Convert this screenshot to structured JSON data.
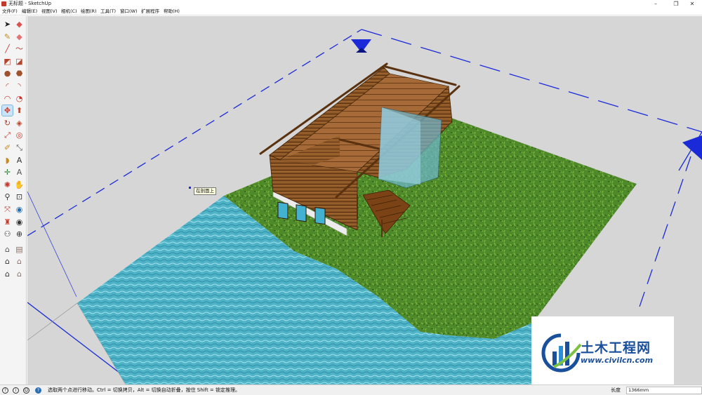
{
  "window": {
    "title": "无标题 - SketchUp",
    "min_glyph": "–",
    "max_glyph": "❐",
    "close_glyph": "✕"
  },
  "menu": [
    "文件(F)",
    "编辑(E)",
    "视图(V)",
    "相机(C)",
    "绘图(R)",
    "工具(T)",
    "窗口(W)",
    "扩展程序",
    "帮助(H)"
  ],
  "toolbar": {
    "tools": [
      {
        "name": "select-tool-icon",
        "glyph": "➤",
        "color": "#222222"
      },
      {
        "name": "eraser-tool-icon",
        "glyph": "◆",
        "color": "#d9534f"
      },
      {
        "name": "paint-bucket-icon",
        "glyph": "✎",
        "color": "#c98a1b"
      },
      {
        "name": "eraser-pink-icon",
        "glyph": "◆",
        "color": "#e57373"
      },
      {
        "name": "line-tool-icon",
        "glyph": "╱",
        "color": "#c0392b"
      },
      {
        "name": "freehand-tool-icon",
        "glyph": "〜",
        "color": "#c0392b"
      },
      {
        "name": "rectangle-tool-icon",
        "glyph": "◩",
        "color": "#b5442e"
      },
      {
        "name": "rotated-rectangle-icon",
        "glyph": "◪",
        "color": "#b5442e"
      },
      {
        "name": "circle-tool-icon",
        "glyph": "●",
        "color": "#a0522d"
      },
      {
        "name": "polygon-tool-icon",
        "glyph": "⬣",
        "color": "#a0522d"
      },
      {
        "name": "arc-tool-icon",
        "glyph": "◜",
        "color": "#c0392b"
      },
      {
        "name": "two-point-arc-icon",
        "glyph": "◝",
        "color": "#c0392b"
      },
      {
        "name": "three-point-arc-icon",
        "glyph": "◠",
        "color": "#c0392b"
      },
      {
        "name": "pie-tool-icon",
        "glyph": "◔",
        "color": "#c0392b"
      },
      {
        "name": "move-tool-icon",
        "glyph": "✥",
        "color": "#c0392b"
      },
      {
        "name": "push-pull-icon",
        "glyph": "⬆",
        "color": "#b5442e"
      },
      {
        "name": "rotate-tool-icon",
        "glyph": "↻",
        "color": "#c0392b"
      },
      {
        "name": "follow-me-icon",
        "glyph": "◈",
        "color": "#b5442e"
      },
      {
        "name": "scale-tool-icon",
        "glyph": "⤢",
        "color": "#c0392b"
      },
      {
        "name": "offset-tool-icon",
        "glyph": "◎",
        "color": "#c0392b"
      },
      {
        "name": "tape-measure-icon",
        "glyph": "✐",
        "color": "#c98a1b"
      },
      {
        "name": "dimension-tool-icon",
        "glyph": "⤡",
        "color": "#555555"
      },
      {
        "name": "protractor-icon",
        "glyph": "◗",
        "color": "#c98a1b"
      },
      {
        "name": "text-tool-icon",
        "glyph": "A",
        "color": "#333333"
      },
      {
        "name": "axes-tool-icon",
        "glyph": "✛",
        "color": "#2e7d32"
      },
      {
        "name": "3d-text-icon",
        "glyph": "A",
        "color": "#555555"
      },
      {
        "name": "orbit-tool-icon",
        "glyph": "✺",
        "color": "#c0392b"
      },
      {
        "name": "pan-tool-icon",
        "glyph": "✋",
        "color": "#555555"
      },
      {
        "name": "zoom-tool-icon",
        "glyph": "⚲",
        "color": "#333333"
      },
      {
        "name": "zoom-window-icon",
        "glyph": "⊡",
        "color": "#333333"
      },
      {
        "name": "zoom-extents-icon",
        "glyph": "⤧",
        "color": "#c0392b"
      },
      {
        "name": "previous-view-icon",
        "glyph": "◉",
        "color": "#1f6fb2"
      },
      {
        "name": "position-camera-icon",
        "glyph": "♜",
        "color": "#c0392b"
      },
      {
        "name": "look-around-icon",
        "glyph": "◉",
        "color": "#333333"
      },
      {
        "name": "walk-tool-icon",
        "glyph": "⚇",
        "color": "#333333"
      },
      {
        "name": "section-plane-icon",
        "glyph": "⊕",
        "color": "#333333"
      },
      {
        "name": "warehouse-icon",
        "glyph": "⌂",
        "color": "#555555"
      },
      {
        "name": "extension-warehouse-icon",
        "glyph": "▤",
        "color": "#8d6e63"
      },
      {
        "name": "home-view-icon",
        "glyph": "⌂",
        "color": "#333333"
      },
      {
        "name": "front-view-icon",
        "glyph": "⌂",
        "color": "#8d6e63"
      },
      {
        "name": "top-view-icon",
        "glyph": "⌂",
        "color": "#333333"
      },
      {
        "name": "side-view-icon",
        "glyph": "⌂",
        "color": "#8d6e63"
      }
    ]
  },
  "viewport": {
    "tooltip": "在剖面上",
    "background": "#d6d6d6",
    "grass_color": "#4f8a2a",
    "water_color": "#4fb3c8",
    "axis_color": "#1a2ad8"
  },
  "watermark": {
    "title": "土木工程网",
    "url": "www.civilcn.com"
  },
  "statusbar": {
    "icons": [
      "?",
      "i",
      "☺",
      "?"
    ],
    "message": "选取两个点进行移动。Ctrl = 切换拷贝，Alt = 切换自动折叠，按住 Shift = 锁定推理。",
    "measure_label": "长度",
    "measure_value": "1366mm"
  }
}
